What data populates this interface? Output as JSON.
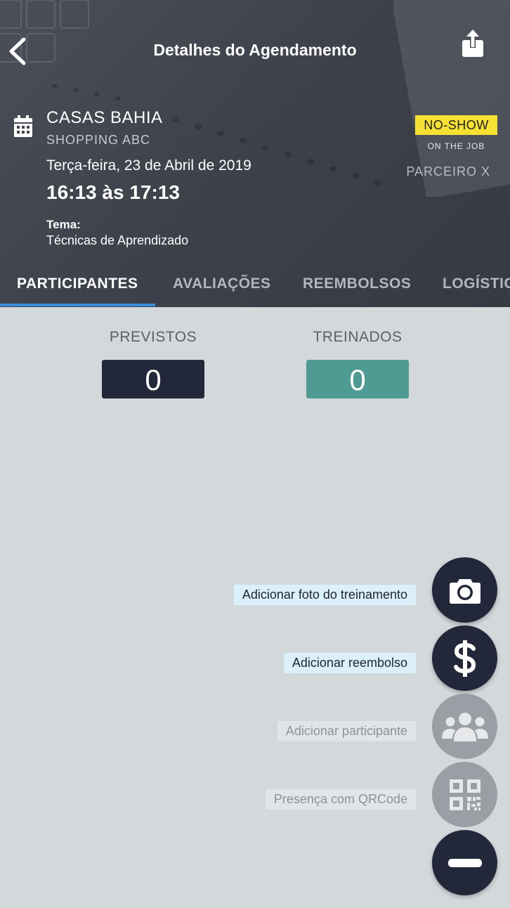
{
  "header": {
    "title": "Detalhes do Agendamento",
    "store_name": "CASAS BAHIA",
    "store_location": "SHOPPING ABC",
    "date": "Terça-feira, 23 de Abril de 2019",
    "time": "16:13 às 17:13",
    "tema_label": "Tema:",
    "tema_value": "Técnicas de Aprendizado",
    "status_badge": "NO-SHOW",
    "status_sub": "ON THE JOB",
    "partner": "PARCEIRO X",
    "badge_color": "#f6e132"
  },
  "tabs": [
    {
      "label": "PARTICIPANTES",
      "active": true
    },
    {
      "label": "AVALIAÇÕES",
      "active": false
    },
    {
      "label": "REEMBOLSOS",
      "active": false
    },
    {
      "label": "LOGÍSTIC",
      "active": false
    }
  ],
  "counters": {
    "previstos_label": "PREVISTOS",
    "previstos_value": "0",
    "treinados_label": "TREINADOS",
    "treinados_value": "0"
  },
  "actions": [
    {
      "label": "Adicionar foto do treinamento",
      "icon": "camera-icon",
      "enabled": true
    },
    {
      "label": "Adicionar reembolso",
      "icon": "dollar-icon",
      "enabled": true
    },
    {
      "label": "Adicionar participante",
      "icon": "group-icon",
      "enabled": false
    },
    {
      "label": "Presença com QRCode",
      "icon": "qrcode-icon",
      "enabled": false
    }
  ],
  "fab_close_icon": "minus-icon",
  "colors": {
    "accent": "#3a8fe0",
    "dark": "#222839",
    "teal": "#4f9b93"
  }
}
